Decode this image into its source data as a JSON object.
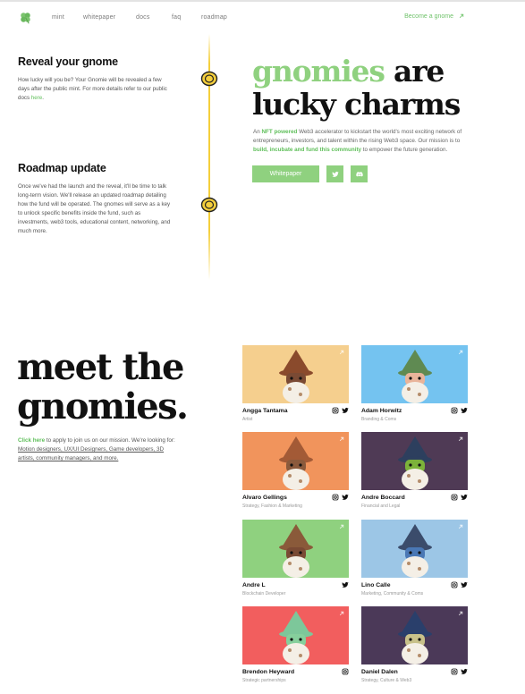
{
  "nav": {
    "links": [
      "mint",
      "whitepaper",
      "docs",
      "faq",
      "roadmap"
    ],
    "cta": "Become a gnome"
  },
  "roadmap": [
    {
      "title": "Reveal your gnome",
      "text": "How lucky will you be? Your Gnomie will be revealed a few days after the public mint. For more details refer to our public docs ",
      "link": "here",
      "tail": "."
    },
    {
      "title": "Roadmap update",
      "text": "Once we've had the launch and the reveal, it'll be time to talk long-term vision. We'll release an updated roadmap detailing how the fund will be operated. The gnomes will serve as a key to unlock specific benefits inside the fund, such as investments, web3 tools, educational content, networking, and much more."
    }
  ],
  "hero": {
    "title_green": "gnomies",
    "title_rest": " are",
    "title_line2": "lucky charms",
    "desc_a": "An ",
    "desc_b": "NFT powered",
    "desc_c": " Web3 accelerator to kickstart the world's most exciting network of entrepreneurs, investors, and talent within the rising Web3 space. Our mission is to ",
    "desc_d": "build, incubate and fund this community",
    "desc_e": " to empower the future generation.",
    "btn_whitepaper": "Whitepaper"
  },
  "meet": {
    "title_line1": "meet the",
    "title_line2": "gnomies.",
    "click": "Click here",
    "text_a": " to apply to join us on our mission. We're looking for: ",
    "text_links": "Motion designers, UX/UI Designers, Game developers, 3D artists, community managers, and more."
  },
  "team": [
    {
      "name": "Angga Tantama",
      "role": "Artist",
      "bg": "#f5cf8e",
      "hat": "#8a4a2c",
      "face": "#7a4a34",
      "icons": [
        "instagram",
        "twitter"
      ]
    },
    {
      "name": "Adam Horwitz",
      "role": "Branding & Coms",
      "bg": "#74c3f0",
      "hat": "#5f8a52",
      "face": "#e9b49a",
      "icons": [
        "instagram",
        "twitter"
      ]
    },
    {
      "name": "Alvaro Gellings",
      "role": "Strategy, Fashion & Marketing",
      "bg": "#f1945c",
      "hat": "#a35a36",
      "face": "#8b5a3c",
      "icons": [
        "instagram",
        "twitter"
      ]
    },
    {
      "name": "Andre Boccard",
      "role": "Financial and Legal",
      "bg": "#4f3a55",
      "hat": "#2d3f5e",
      "face": "#7cb23a",
      "icons": [
        "instagram",
        "twitter"
      ]
    },
    {
      "name": "Andre L",
      "role": "Blockchain Developer",
      "bg": "#8fd17f",
      "hat": "#8a5a3a",
      "face": "#7a4a34",
      "icons": [
        "twitter"
      ]
    },
    {
      "name": "Lino Calle",
      "role": "Marketing, Community & Coms",
      "bg": "#9cc6e6",
      "hat": "#3b4c6b",
      "face": "#4a78b5",
      "icons": [
        "instagram",
        "twitter"
      ]
    },
    {
      "name": "Brendon Heyward",
      "role": "Strategic partnerships",
      "bg": "#f25e5e",
      "hat": "#7dc79a",
      "face": "#86cf9c",
      "icons": [
        "instagram"
      ]
    },
    {
      "name": "Daniel Dalen",
      "role": "Strategy, Culture & Web3",
      "bg": "#4b3958",
      "hat": "#2a3f6b",
      "face": "#c8c18a",
      "icons": [
        "instagram",
        "twitter"
      ]
    }
  ]
}
